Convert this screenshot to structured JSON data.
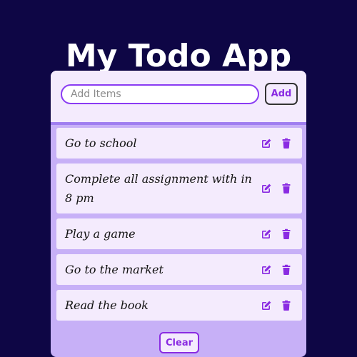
{
  "header": {
    "title": "My Todo App"
  },
  "form": {
    "input_placeholder": "Add Items",
    "input_value": "",
    "add_label": "Add"
  },
  "todos": [
    {
      "text": "Go to school",
      "edit_icon": "edit-icon",
      "delete_icon": "trash-icon"
    },
    {
      "text": "Complete all assignment with in 8 pm",
      "edit_icon": "edit-icon",
      "delete_icon": "trash-icon"
    },
    {
      "text": "Play a game",
      "edit_icon": "edit-icon",
      "delete_icon": "trash-icon"
    },
    {
      "text": "Go to the market",
      "edit_icon": "edit-icon",
      "delete_icon": "trash-icon"
    },
    {
      "text": "Read the book",
      "edit_icon": "edit-icon",
      "delete_icon": "trash-icon"
    }
  ],
  "footer": {
    "clear_label": "Clear"
  },
  "colors": {
    "background": "#0e0645",
    "card": "#c7b0f7",
    "item": "#f4ebfd",
    "accent": "#8a2be2"
  }
}
